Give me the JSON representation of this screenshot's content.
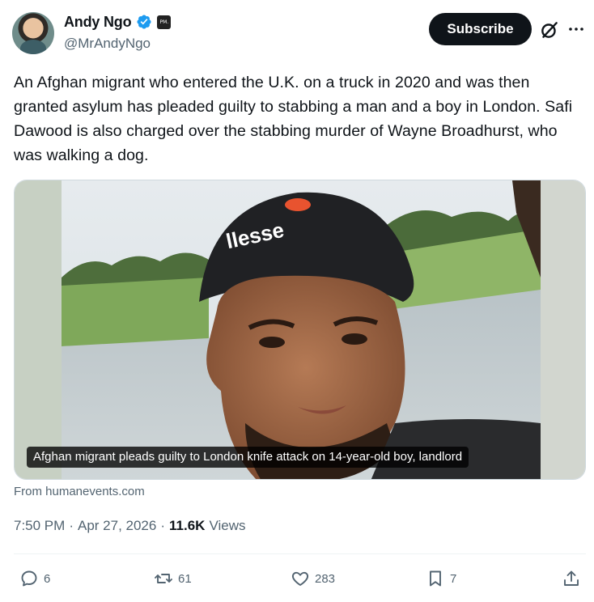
{
  "author": {
    "name": "Andy Ngo",
    "handle": "@MrAndyNgo",
    "verified_icon": "verified-badge-icon",
    "affiliate_badge_text": "PM."
  },
  "header_actions": {
    "subscribe_label": "Subscribe",
    "grok_icon": "grok-icon",
    "more_icon": "more-icon"
  },
  "tweet": {
    "text": "An Afghan migrant who entered the U.K. on a truck in 2020 and was then granted asylum has pleaded guilty to stabbing a man and a boy in London. Safi Dawood is also charged over the stabbing murder of Wayne Broadhurst, who was walking a dog.",
    "card_caption": "Afghan migrant pleads guilty to London knife attack on 14-year-old boy, landlord",
    "card_source": "From humanevents.com",
    "time": "7:50 PM",
    "date": "Apr 27, 2026",
    "views_count": "11.6K",
    "views_label": "Views",
    "separator": "·"
  },
  "actions": {
    "replies": "6",
    "reposts": "61",
    "likes": "283",
    "bookmarks": "7"
  },
  "colors": {
    "text": "#0f1419",
    "secondary": "#536471",
    "verified": "#1d9bf0",
    "subscribe_bg": "#0f1419"
  }
}
